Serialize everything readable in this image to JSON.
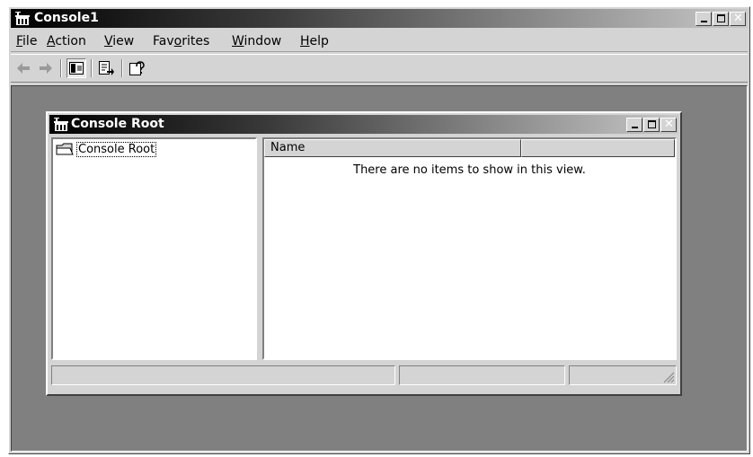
{
  "window": {
    "title": "Console1"
  },
  "menu": {
    "items": [
      {
        "label": "File",
        "accel": "F",
        "rest": "ile",
        "pre": ""
      },
      {
        "label": "Action",
        "accel": "A",
        "rest": "ction",
        "pre": ""
      },
      {
        "label": "View",
        "accel": "V",
        "rest": "iew",
        "pre": ""
      },
      {
        "label": "Favorites",
        "pre": "Fav",
        "accel": "o",
        "rest": "rites"
      },
      {
        "label": "Window",
        "accel": "W",
        "rest": "indow",
        "pre": ""
      },
      {
        "label": "Help",
        "accel": "H",
        "rest": "elp",
        "pre": ""
      }
    ]
  },
  "toolbar": {
    "buttons": [
      {
        "name": "back-button",
        "icon": "arrow-left-icon"
      },
      {
        "name": "forward-button",
        "icon": "arrow-right-icon"
      },
      {
        "name": "show-hide-console-tree-button",
        "icon": "console-tree-icon"
      },
      {
        "name": "export-list-button",
        "icon": "export-list-icon"
      },
      {
        "name": "help-button",
        "icon": "help-icon"
      }
    ]
  },
  "child": {
    "title": "Console Root",
    "tree": {
      "root_label": "Console Root"
    },
    "list": {
      "columns": [
        "Name",
        ""
      ],
      "empty_message": "There are no items to show in this view."
    }
  },
  "colors": {
    "titlebar_start": "#000000",
    "titlebar_end": "#c8c8c8",
    "face": "#d4d4d4",
    "mdi_background": "#808080"
  }
}
